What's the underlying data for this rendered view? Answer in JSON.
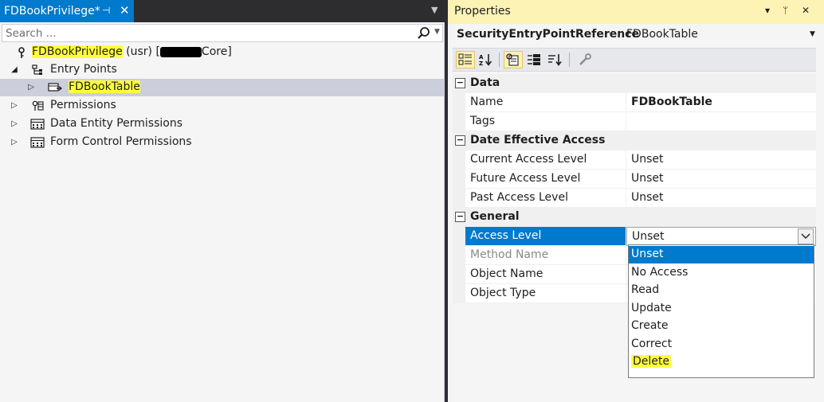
{
  "left_pane": {
    "tab": {
      "title": "FDBookPrivilege*",
      "pin": "⊣",
      "close": "✕"
    },
    "search": {
      "placeholder": "Search ...",
      "value": ""
    },
    "tree": [
      {
        "label": "FDBookPrivilege",
        "suffix": " (usr) [",
        "suffix2": "Core]",
        "expander": "",
        "icon": "key-icon"
      },
      {
        "label": "Entry Points",
        "expander": "◢",
        "icon": "entry-points-icon"
      },
      {
        "label": "FDBookTable",
        "expander": "▷",
        "icon": "entry-point-icon",
        "selected": true
      },
      {
        "label": "Permissions",
        "expander": "▷",
        "icon": "permissions-icon"
      },
      {
        "label": "Data Entity Permissions",
        "expander": "▷",
        "icon": "table-icon"
      },
      {
        "label": "Form Control Permissions",
        "expander": "▷",
        "icon": "form-icon"
      }
    ]
  },
  "properties": {
    "title": "Properties",
    "title_buttons": {
      "dropdown": "▾",
      "pin": "ᛘ",
      "close": "✕"
    },
    "object_type": "SecurityEntryPointReference",
    "object_name": "FDBookTable",
    "categories": [
      {
        "label": "Data",
        "toggle": "−",
        "rows": [
          {
            "name": "Name",
            "value": "FDBookTable",
            "bold": true
          },
          {
            "name": "Tags",
            "value": ""
          }
        ]
      },
      {
        "label": "Date Effective Access",
        "toggle": "−",
        "rows": [
          {
            "name": "Current Access Level",
            "value": "Unset"
          },
          {
            "name": "Future Access Level",
            "value": "Unset"
          },
          {
            "name": "Past Access Level",
            "value": "Unset"
          }
        ]
      },
      {
        "label": "General",
        "toggle": "−",
        "rows": [
          {
            "name": "Access Level",
            "value": "Unset",
            "selected": true
          },
          {
            "name": "Method Name",
            "value": "",
            "dim": true
          },
          {
            "name": "Object Name",
            "value": ""
          },
          {
            "name": "Object Type",
            "value": ""
          }
        ]
      }
    ],
    "dropdown_options": [
      "Unset",
      "No Access",
      "Read",
      "Update",
      "Create",
      "Correct",
      "Delete"
    ],
    "dropdown_selected": "Unset",
    "dropdown_highlighted": "Delete"
  },
  "colors": {
    "accent": "#007acc",
    "highlight": "#ffff3d",
    "properties_titlebar": "#fcf3b5"
  }
}
